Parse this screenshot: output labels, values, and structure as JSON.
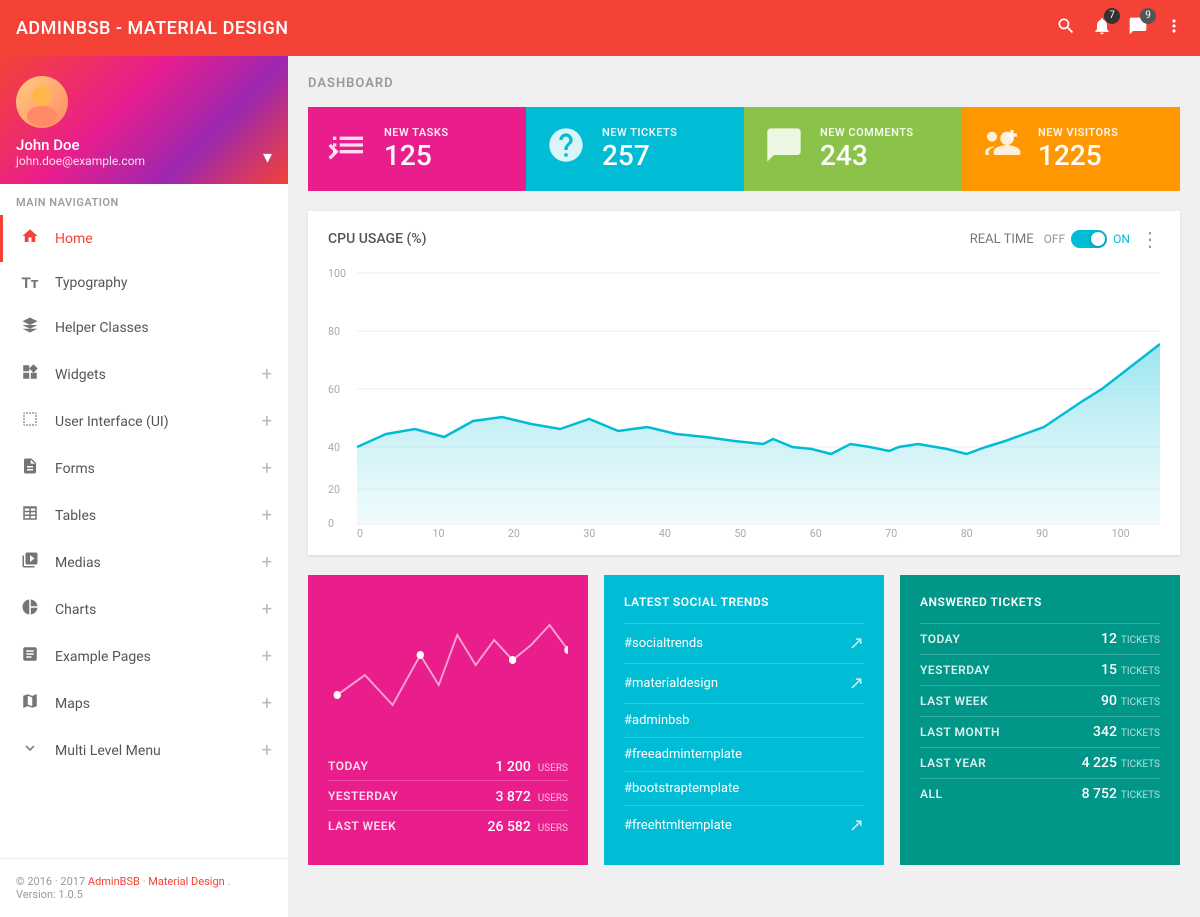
{
  "topbar": {
    "title": "ADMINBSB - MATERIAL DESIGN",
    "notification_badge": "7",
    "message_badge": "9"
  },
  "sidebar": {
    "profile": {
      "name": "John Doe",
      "email": "john.doe@example.com",
      "avatar_emoji": "👤"
    },
    "nav_label": "MAIN NAVIGATION",
    "items": [
      {
        "id": "home",
        "label": "Home",
        "icon": "🏠",
        "active": true,
        "has_plus": false
      },
      {
        "id": "typography",
        "label": "Typography",
        "icon": "Tт",
        "active": false,
        "has_plus": false
      },
      {
        "id": "helper-classes",
        "label": "Helper Classes",
        "icon": "◆",
        "active": false,
        "has_plus": false
      },
      {
        "id": "widgets",
        "label": "Widgets",
        "icon": "⊞",
        "active": false,
        "has_plus": true
      },
      {
        "id": "ui",
        "label": "User Interface (UI)",
        "icon": "∿",
        "active": false,
        "has_plus": true
      },
      {
        "id": "forms",
        "label": "Forms",
        "icon": "▤",
        "active": false,
        "has_plus": true
      },
      {
        "id": "tables",
        "label": "Tables",
        "icon": "≡",
        "active": false,
        "has_plus": true
      },
      {
        "id": "medias",
        "label": "Medias",
        "icon": "▦",
        "active": false,
        "has_plus": true
      },
      {
        "id": "charts",
        "label": "Charts",
        "icon": "◑",
        "active": false,
        "has_plus": true
      },
      {
        "id": "example-pages",
        "label": "Example Pages",
        "icon": "📄",
        "active": false,
        "has_plus": true
      },
      {
        "id": "maps",
        "label": "Maps",
        "icon": "🗺",
        "active": false,
        "has_plus": true
      },
      {
        "id": "multi-level",
        "label": "Multi Level Menu",
        "icon": "∿",
        "active": false,
        "has_plus": true
      }
    ],
    "footer": {
      "copyright": "© 2016 · 2017 ",
      "link1": "AdminBSB",
      "separator": " · ",
      "link2": "Material Design",
      "suffix": ".",
      "version": "Version: 1.0.5"
    }
  },
  "dashboard": {
    "page_title": "DASHBOARD",
    "stat_cards": [
      {
        "id": "tasks",
        "color": "pink",
        "label": "NEW TASKS",
        "value": "125"
      },
      {
        "id": "tickets",
        "color": "teal",
        "label": "NEW TICKETS",
        "value": "257"
      },
      {
        "id": "comments",
        "color": "green",
        "label": "NEW COMMENTS",
        "value": "243"
      },
      {
        "id": "visitors",
        "color": "orange",
        "label": "NEW VISITORS",
        "value": "1225"
      }
    ],
    "cpu_chart": {
      "title": "CPU USAGE (%)",
      "realtime_label": "REAL TIME",
      "off_label": "OFF",
      "on_label": "ON"
    },
    "sparkline_card": {
      "rows": [
        {
          "period": "TODAY",
          "value": "1 200",
          "unit": "USERS"
        },
        {
          "period": "YESTERDAY",
          "value": "3 872",
          "unit": "USERS"
        },
        {
          "period": "LAST WEEK",
          "value": "26 582",
          "unit": "USERS"
        }
      ]
    },
    "social_trends": {
      "title": "LATEST SOCIAL TRENDS",
      "items": [
        {
          "tag": "#socialtrends",
          "has_arrow": true
        },
        {
          "tag": "#materialdesign",
          "has_arrow": true
        },
        {
          "tag": "#adminbsb",
          "has_arrow": false
        },
        {
          "tag": "#freeadmintemplate",
          "has_arrow": false
        },
        {
          "tag": "#bootstraptemplate",
          "has_arrow": false
        },
        {
          "tag": "#freehtmltemplate",
          "has_arrow": true
        }
      ]
    },
    "answered_tickets": {
      "title": "ANSWERED TICKETS",
      "rows": [
        {
          "period": "TODAY",
          "count": "12",
          "unit": "TICKETS"
        },
        {
          "period": "YESTERDAY",
          "count": "15",
          "unit": "TICKETS"
        },
        {
          "period": "LAST WEEK",
          "count": "90",
          "unit": "TICKETS"
        },
        {
          "period": "LAST MONTH",
          "count": "342",
          "unit": "TICKETS"
        },
        {
          "period": "LAST YEAR",
          "count": "4 225",
          "unit": "TICKETS"
        },
        {
          "period": "ALL",
          "count": "8 752",
          "unit": "TICKETS"
        }
      ]
    }
  }
}
